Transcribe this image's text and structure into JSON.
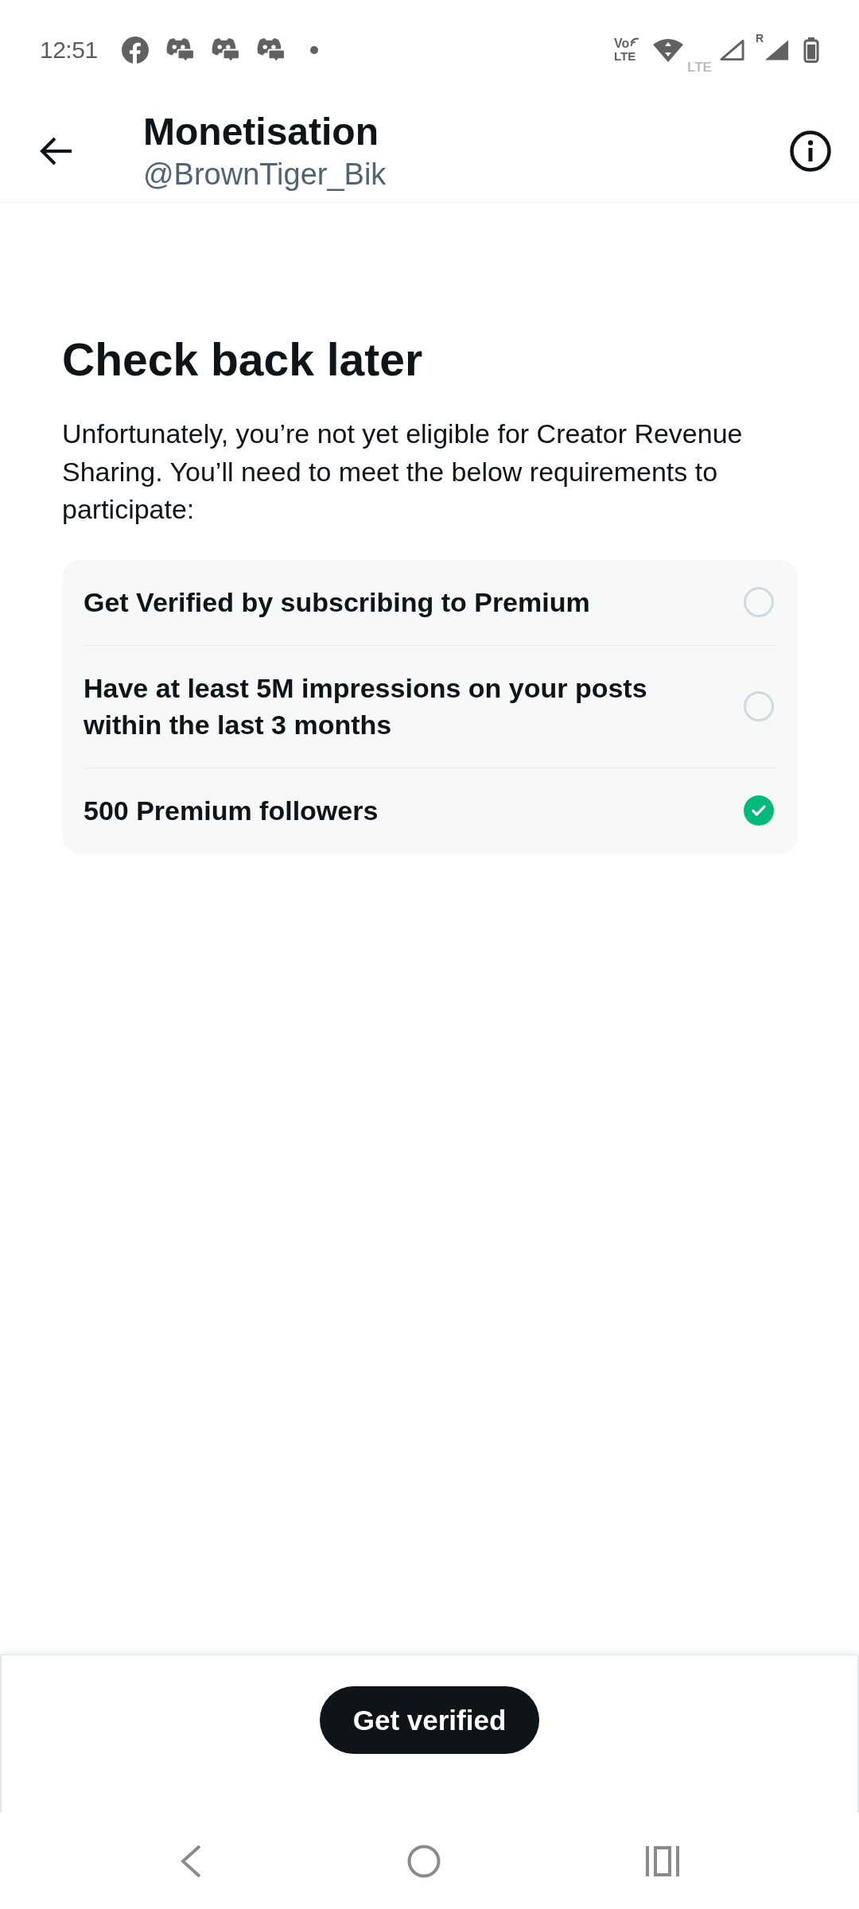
{
  "status_bar": {
    "time": "12:51",
    "notifications": [
      {
        "kind": "facebook"
      },
      {
        "kind": "discord"
      },
      {
        "kind": "discord"
      },
      {
        "kind": "discord"
      },
      {
        "kind": "more"
      }
    ],
    "network": {
      "volte_top": "Vo",
      "volte_bottom": "LTE",
      "data_type": "LTE",
      "roaming": "R"
    }
  },
  "header": {
    "title": "Monetisation",
    "handle": "@BrownTiger_Bik"
  },
  "content": {
    "heading": "Check back later",
    "message": "Unfortunately, you’re not yet eligible for Creator Revenue Sharing. You’ll need to meet the below requirements to participate:"
  },
  "requirements": [
    {
      "label": "Get Verified by subscribing to Premium",
      "checked": false
    },
    {
      "label": "Have at least 5M impressions on your posts within the last 3 months",
      "checked": false
    },
    {
      "label": "500 Premium followers",
      "checked": true
    }
  ],
  "footer": {
    "button": "Get verified"
  }
}
